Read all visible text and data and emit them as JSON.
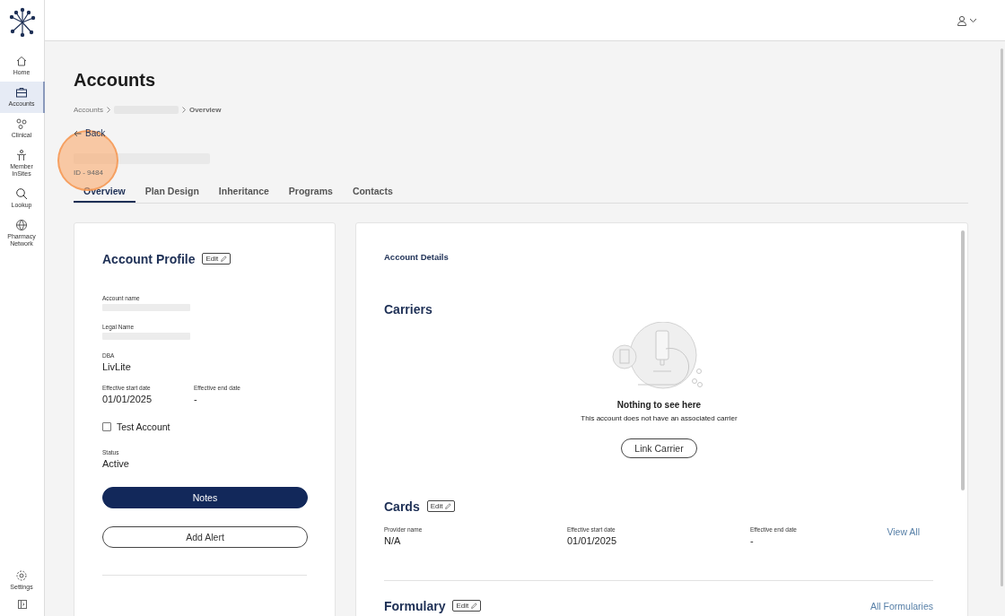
{
  "sidebar": {
    "items": [
      {
        "kind": "home",
        "label": "Home",
        "selected": false
      },
      {
        "kind": "briefcase",
        "label": "Accounts",
        "selected": true
      },
      {
        "kind": "clinical",
        "label": "Clinical",
        "selected": false
      },
      {
        "kind": "people",
        "label": "Member InSites",
        "selected": false
      },
      {
        "kind": "search",
        "label": "Lookup",
        "selected": false
      },
      {
        "kind": "globe",
        "label": "Pharmacy Network",
        "selected": false
      }
    ],
    "footer": [
      {
        "kind": "gear",
        "label": "Settings"
      }
    ]
  },
  "page": {
    "title": "Accounts",
    "breadcrumb": [
      {
        "label": "Accounts",
        "current": false
      },
      {
        "kind": "redacted"
      },
      {
        "label": "Overview",
        "current": true
      }
    ],
    "back": "Back",
    "account_id": "ID - 9484",
    "tabs": [
      {
        "label": "Overview",
        "selected": true
      },
      {
        "label": "Plan Design",
        "selected": false
      },
      {
        "label": "Inheritance",
        "selected": false
      },
      {
        "label": "Programs",
        "selected": false
      },
      {
        "label": "Contacts",
        "selected": false
      }
    ]
  },
  "profile": {
    "title": "Account Profile",
    "edit": "Edit",
    "fields": [
      {
        "label": "Account name",
        "kind": "redacted"
      },
      {
        "label": "Legal Name",
        "kind": "redacted"
      },
      {
        "label": "DBA",
        "kind": "text",
        "value": "LivLite"
      }
    ],
    "dates": [
      {
        "label": "Effective start date",
        "value": "01/01/2025"
      },
      {
        "label": "Effective end date",
        "value": "-"
      }
    ],
    "test_account": {
      "label": "Test Account",
      "checked": false
    },
    "status": {
      "label": "Status",
      "value": "Active"
    },
    "buttons": [
      {
        "label": "Notes",
        "kind": "primary"
      },
      {
        "label": "Add Alert",
        "kind": "outline"
      }
    ]
  },
  "details": {
    "title": "Account Details",
    "carriers": {
      "title": "Carriers",
      "empty_title": "Nothing to see here",
      "empty_message": "This account does not have an associated carrier",
      "button": "Link Carrier"
    },
    "cards": {
      "title": "Cards",
      "edit": "Edit",
      "columns": [
        {
          "label": "Provider name",
          "value": "N/A"
        },
        {
          "label": "Effective start date",
          "value": "01/01/2025"
        },
        {
          "label": "Effective end date",
          "value": "-"
        }
      ],
      "link": "View All"
    },
    "formulary": {
      "title": "Formulary",
      "edit": "Edit",
      "link": "All Formularies"
    }
  }
}
